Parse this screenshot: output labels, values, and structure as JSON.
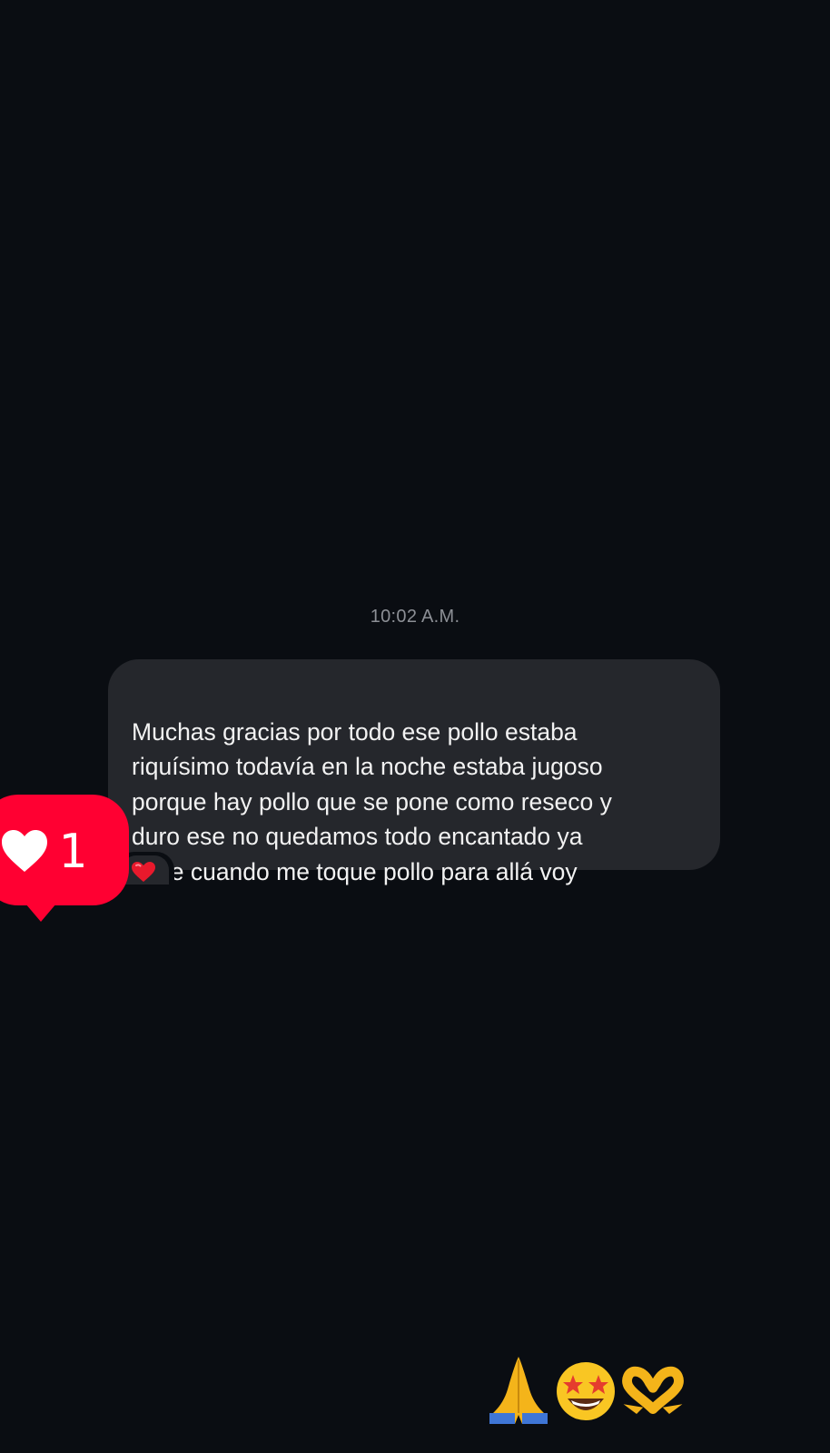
{
  "conversation": {
    "timestamp": "10:02 A.M.",
    "message": {
      "text": "Muchas gracias por todo ese pollo estaba\nriquísimo todavía en la noche estaba jugoso\nporque hay pollo que se pone como reseco y\nduro ese no quedamos todo encantado ya\nsabe cuando me toque pollo para allá voy",
      "reaction_icon": "red-heart-icon"
    },
    "notification": {
      "icon": "heart-icon",
      "count": "1",
      "color": "#ff0032"
    },
    "reply_emojis": [
      "folded-hands-icon",
      "star-struck-icon",
      "heart-hands-icon"
    ]
  },
  "colors": {
    "background": "#0a0d12",
    "bubble": "#25272c",
    "text": "#f2f2f2",
    "timestamp": "#8c8f95",
    "accent": "#ff0032"
  }
}
